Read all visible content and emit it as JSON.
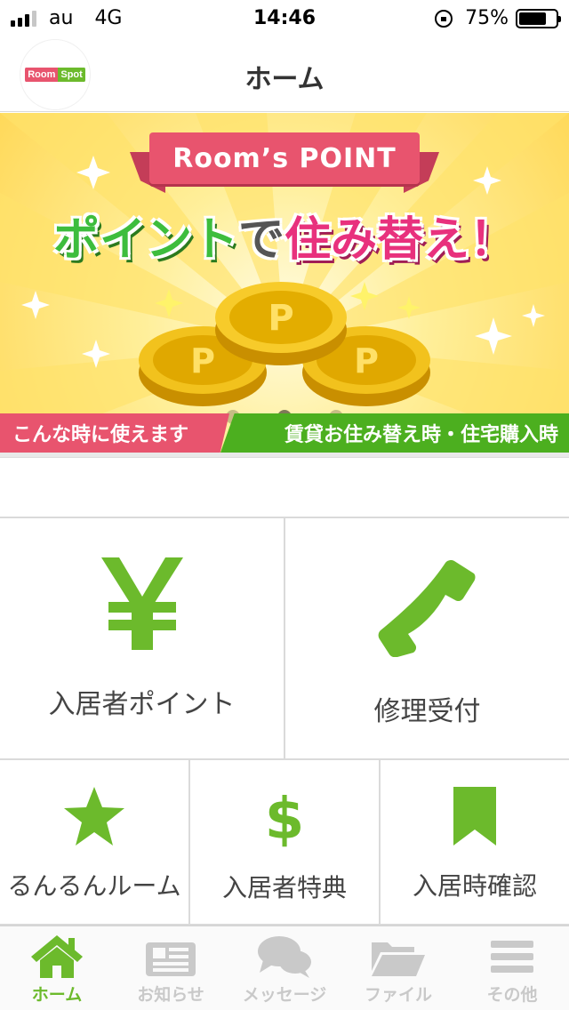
{
  "status_bar": {
    "carrier": "au",
    "network": "4G",
    "time": "14:46",
    "battery_percent": "75%",
    "battery_level": 0.75
  },
  "nav": {
    "title": "ホーム",
    "logo": {
      "left": "Room",
      "right": "Spot"
    }
  },
  "banner": {
    "ribbon_text": "Room’s POINT",
    "headline": {
      "green": "ポイント",
      "mid": "で",
      "pink": "住み替え！"
    },
    "coin_letter": "P",
    "footer_left": "こんな時に使えます",
    "footer_right": "賃貸お住み替え時・住宅購入時",
    "slides": 3,
    "active_slide": 2
  },
  "tiles_row1": [
    {
      "label": "入居者ポイント",
      "icon": "yen-icon"
    },
    {
      "label": "修理受付",
      "icon": "phone-icon"
    }
  ],
  "tiles_row2": [
    {
      "label": "るんるんルーム",
      "icon": "star-icon"
    },
    {
      "label": "入居者特典",
      "icon": "dollar-icon"
    },
    {
      "label": "入居時確認",
      "icon": "bookmark-icon"
    }
  ],
  "tab_bar": [
    {
      "label": "ホーム",
      "icon": "home-icon",
      "active": true
    },
    {
      "label": "お知らせ",
      "icon": "news-icon",
      "active": false
    },
    {
      "label": "メッセージ",
      "icon": "chat-icon",
      "active": false
    },
    {
      "label": "ファイル",
      "icon": "folder-icon",
      "active": false
    },
    {
      "label": "その他",
      "icon": "menu-icon",
      "active": false
    }
  ],
  "colors": {
    "accent_green": "#6cba2c",
    "pink": "#e8546e",
    "inactive_gray": "#c9c9c9"
  }
}
